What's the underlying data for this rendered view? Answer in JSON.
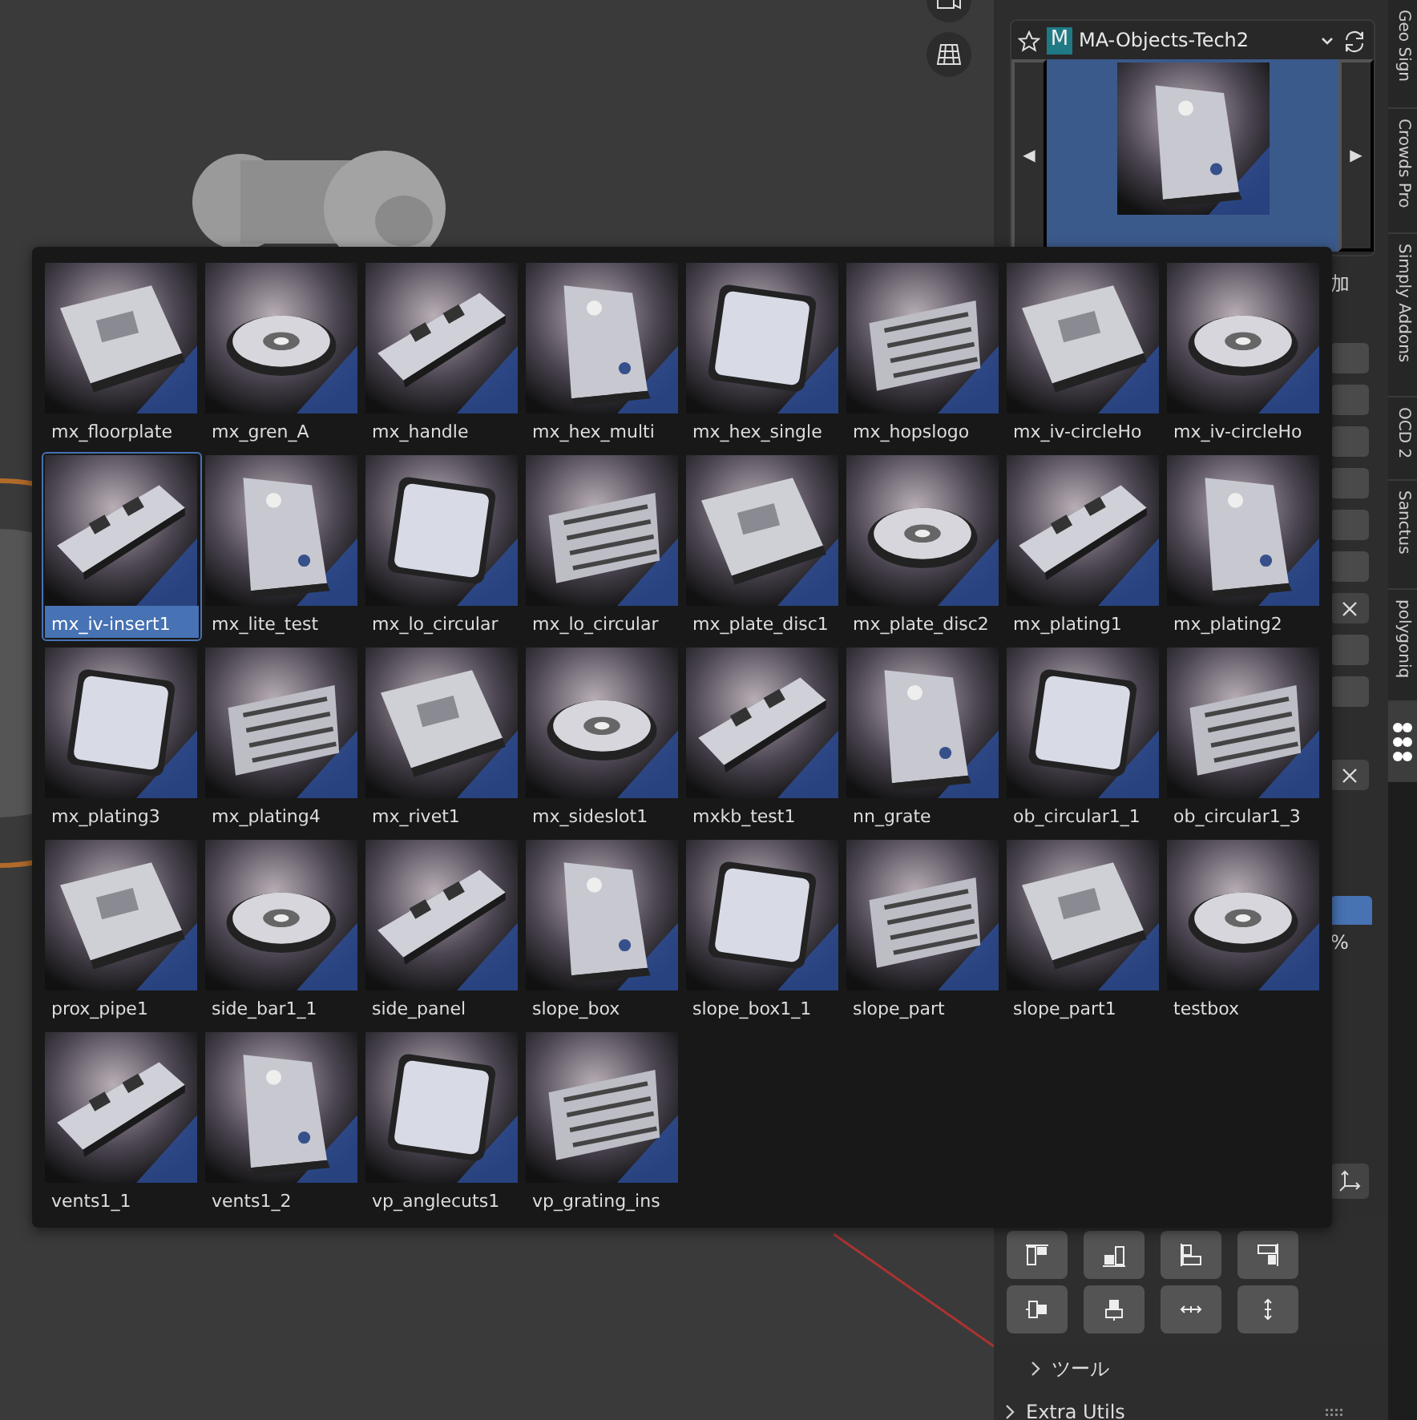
{
  "asset_panel": {
    "library_badge": "M",
    "library": "MA-Objects-Tech2",
    "prev": "◀",
    "next": "▶"
  },
  "side_controls": [
    {
      "kind": "text",
      "text": "加"
    },
    {
      "kind": "field"
    },
    {
      "kind": "field"
    },
    {
      "kind": "field"
    },
    {
      "kind": "field"
    },
    {
      "kind": "field"
    },
    {
      "kind": "field"
    },
    {
      "kind": "clear"
    },
    {
      "kind": "field"
    },
    {
      "kind": "field"
    },
    {
      "kind": "clear"
    },
    {
      "kind": "fill"
    },
    {
      "kind": "text",
      "text": "%"
    },
    {
      "kind": "axis"
    }
  ],
  "sections": [
    {
      "label": "ツール",
      "expanded": false
    },
    {
      "label": "Extra Utils",
      "expanded": false
    }
  ],
  "tabs": [
    {
      "label": "Geo Sign",
      "selected": false
    },
    {
      "label": "Crowds Pro",
      "selected": false
    },
    {
      "label": "Simply Addons",
      "selected": false
    },
    {
      "label": "OCD 2",
      "selected": false
    },
    {
      "label": "Sanctus",
      "selected": false
    },
    {
      "label": "polygoniq",
      "selected": false
    },
    {
      "kind": "icon",
      "selected": true
    }
  ],
  "popup": {
    "items": [
      {
        "label": "mx_floorplate",
        "selected": false
      },
      {
        "label": "mx_gren_A",
        "selected": false
      },
      {
        "label": "mx_handle",
        "selected": false
      },
      {
        "label": "mx_hex_multi",
        "selected": false
      },
      {
        "label": "mx_hex_single",
        "selected": false
      },
      {
        "label": "mx_hopslogo",
        "selected": false
      },
      {
        "label": "mx_iv-circleHo",
        "selected": false
      },
      {
        "label": "mx_iv-circleHo",
        "selected": false
      },
      {
        "label": "mx_iv-insert1",
        "selected": true
      },
      {
        "label": "mx_lite_test",
        "selected": false
      },
      {
        "label": "mx_lo_circular",
        "selected": false
      },
      {
        "label": "mx_lo_circular",
        "selected": false
      },
      {
        "label": "mx_plate_disc1",
        "selected": false
      },
      {
        "label": "mx_plate_disc2",
        "selected": false
      },
      {
        "label": "mx_plating1",
        "selected": false
      },
      {
        "label": "mx_plating2",
        "selected": false
      },
      {
        "label": "mx_plating3",
        "selected": false
      },
      {
        "label": "mx_plating4",
        "selected": false
      },
      {
        "label": "mx_rivet1",
        "selected": false
      },
      {
        "label": "mx_sideslot1",
        "selected": false
      },
      {
        "label": "mxkb_test1",
        "selected": false
      },
      {
        "label": "nn_grate",
        "selected": false
      },
      {
        "label": "ob_circular1_1",
        "selected": false
      },
      {
        "label": "ob_circular1_3",
        "selected": false
      },
      {
        "label": "prox_pipe1",
        "selected": false
      },
      {
        "label": "side_bar1_1",
        "selected": false
      },
      {
        "label": "side_panel",
        "selected": false
      },
      {
        "label": "slope_box",
        "selected": false
      },
      {
        "label": "slope_box1_1",
        "selected": false
      },
      {
        "label": "slope_part",
        "selected": false
      },
      {
        "label": "slope_part1",
        "selected": false
      },
      {
        "label": "testbox",
        "selected": false
      },
      {
        "label": "vents1_1",
        "selected": false
      },
      {
        "label": "vents1_2",
        "selected": false
      },
      {
        "label": "vp_anglecuts1",
        "selected": false
      },
      {
        "label": "vp_grating_ins",
        "selected": false
      }
    ]
  }
}
